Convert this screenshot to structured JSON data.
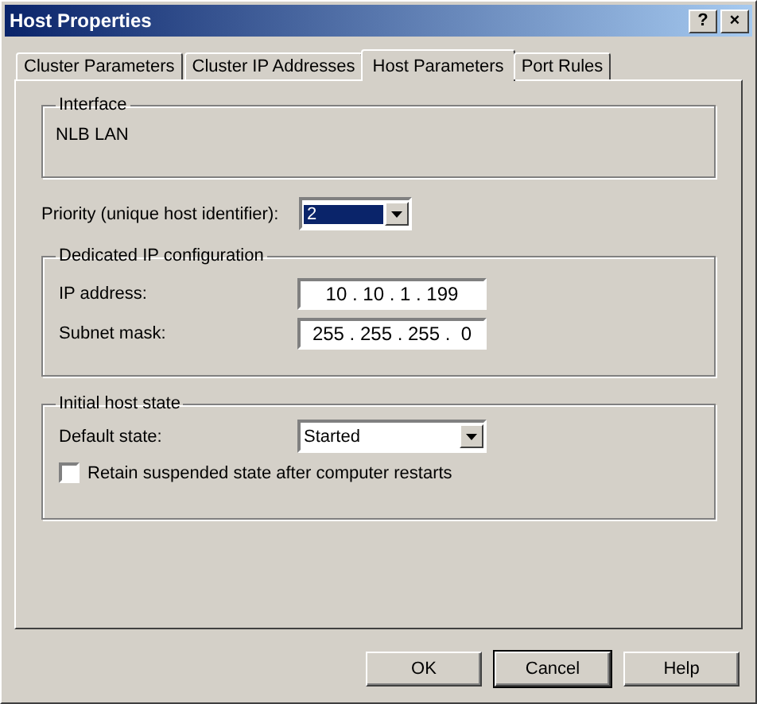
{
  "window": {
    "title": "Host Properties",
    "title_buttons": [
      "?",
      "×"
    ]
  },
  "tabs": [
    {
      "label": "Cluster Parameters",
      "selected": false
    },
    {
      "label": "Cluster IP Addresses",
      "selected": false
    },
    {
      "label": "Host Parameters",
      "selected": true
    },
    {
      "label": "Port Rules",
      "selected": false
    }
  ],
  "interface": {
    "title": "Interface",
    "value": "NLB LAN"
  },
  "priority": {
    "label": "Priority (unique host identifier):",
    "value": "2"
  },
  "dedicated_ip": {
    "title": "Dedicated IP configuration",
    "fields": [
      {
        "label": "IP address:",
        "value": "10 . 10 . 1 . 199"
      },
      {
        "label": "Subnet mask:",
        "value": "255 . 255 . 255 .  0"
      }
    ]
  },
  "initial_host_state": {
    "title": "Initial host state",
    "default_state": {
      "label": "Default state:",
      "value": "Started"
    },
    "retain": {
      "label": "Retain suspended state after computer restarts",
      "checked": false
    }
  },
  "buttons": [
    {
      "label": "OK",
      "default": false
    },
    {
      "label": "Cancel",
      "default": true
    },
    {
      "label": "Help",
      "default": false
    }
  ]
}
